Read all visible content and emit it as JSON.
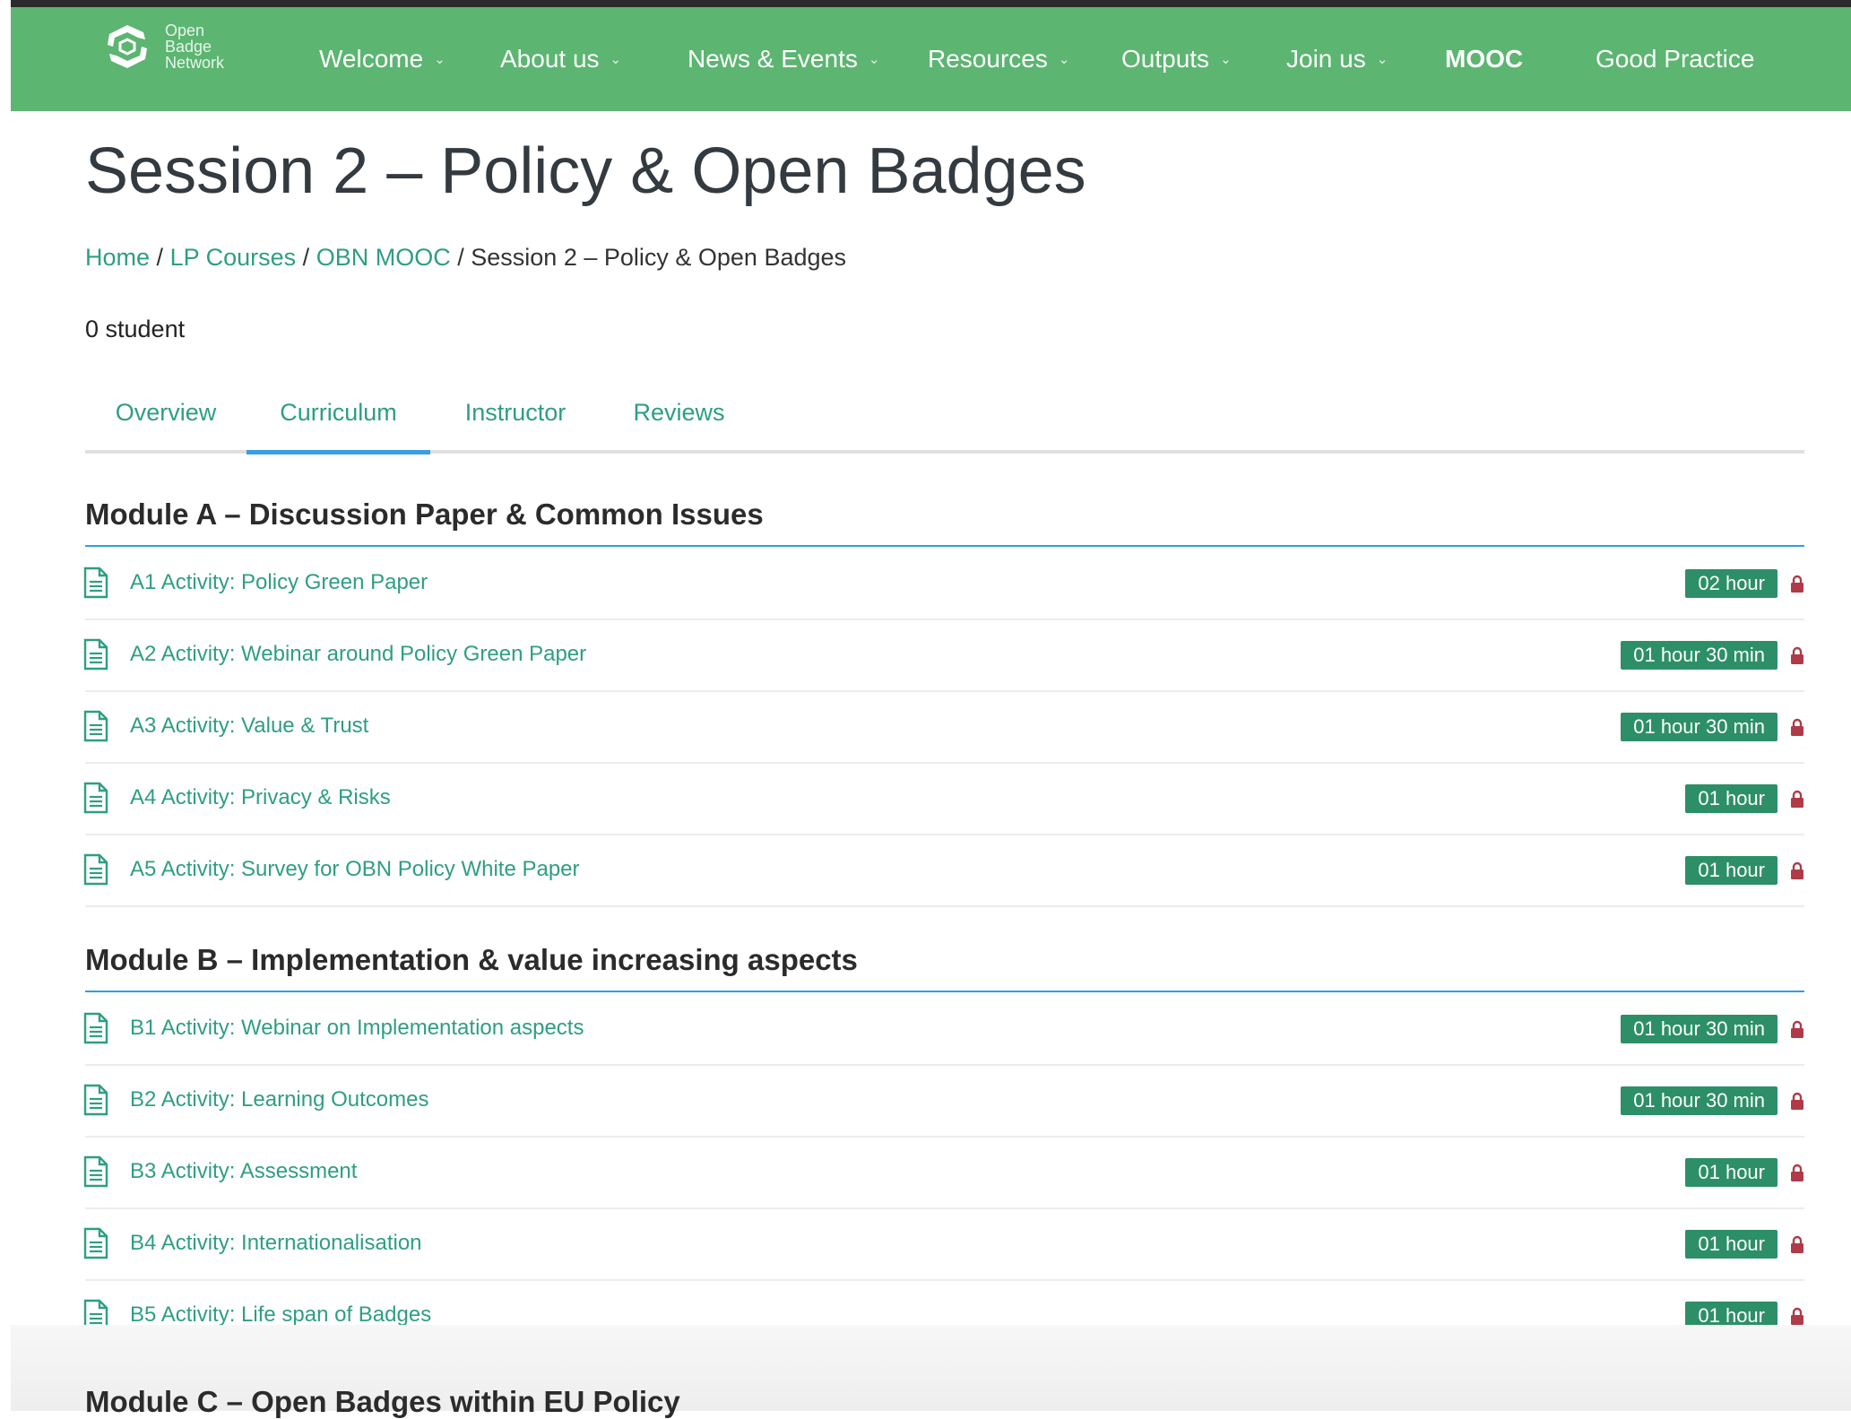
{
  "nav": {
    "logo_lines": [
      "Open",
      "Badge",
      "Network"
    ],
    "items": [
      {
        "label": "Welcome",
        "dropdown": true
      },
      {
        "label": "About us",
        "dropdown": true
      },
      {
        "label": "News & Events",
        "dropdown": true
      },
      {
        "label": "Resources",
        "dropdown": true
      },
      {
        "label": "Outputs",
        "dropdown": true
      },
      {
        "label": "Join us",
        "dropdown": true
      },
      {
        "label": "MOOC",
        "dropdown": false,
        "active": true
      },
      {
        "label": "Good Practice",
        "dropdown": false
      }
    ]
  },
  "page": {
    "title": "Session 2 – Policy & Open Badges",
    "breadcrumb": [
      {
        "label": "Home",
        "link": true
      },
      {
        "label": "LP Courses",
        "link": true
      },
      {
        "label": "OBN MOOC",
        "link": true
      },
      {
        "label": "Session 2 – Policy & Open Badges",
        "link": false
      }
    ],
    "breadcrumb_separator": "/",
    "student_count": "0 student"
  },
  "tabs": [
    {
      "label": "Overview"
    },
    {
      "label": "Curriculum",
      "active": true
    },
    {
      "label": "Instructor"
    },
    {
      "label": "Reviews"
    }
  ],
  "modules": [
    {
      "title": "Module A – Discussion Paper & Common Issues",
      "lessons": [
        {
          "title": "A1 Activity: Policy Green Paper",
          "duration": "02 hour"
        },
        {
          "title": "A2 Activity: Webinar around Policy Green Paper",
          "duration": "01 hour 30 min"
        },
        {
          "title": "A3 Activity: Value & Trust",
          "duration": "01 hour 30 min"
        },
        {
          "title": "A4 Activity: Privacy & Risks",
          "duration": "01 hour"
        },
        {
          "title": "A5 Activity: Survey for OBN Policy White Paper",
          "duration": "01 hour"
        }
      ]
    },
    {
      "title": "Module B – Implementation & value increasing aspects",
      "lessons": [
        {
          "title": "B1 Activity: Webinar on Implementation aspects",
          "duration": "01 hour 30 min"
        },
        {
          "title": "B2 Activity: Learning Outcomes",
          "duration": "01 hour 30 min"
        },
        {
          "title": "B3 Activity: Assessment",
          "duration": "01 hour"
        },
        {
          "title": "B4 Activity: Internationalisation",
          "duration": "01 hour"
        },
        {
          "title": "B5 Activity: Life span of Badges",
          "duration": "01 hour"
        }
      ]
    },
    {
      "title": "Module C – Open Badges within EU Policy",
      "lessons": []
    }
  ],
  "icons": {
    "lesson": "file-text-icon",
    "lock": "lock-icon",
    "dropdown": "chevron-down-icon"
  },
  "colors": {
    "navbar": "#5cb571",
    "link": "#2e9e83",
    "duration_badge": "#2d8f68",
    "lock": "#b03a48",
    "active_tab": "#3a9fe0",
    "module_rule": "#2d9ee6"
  }
}
